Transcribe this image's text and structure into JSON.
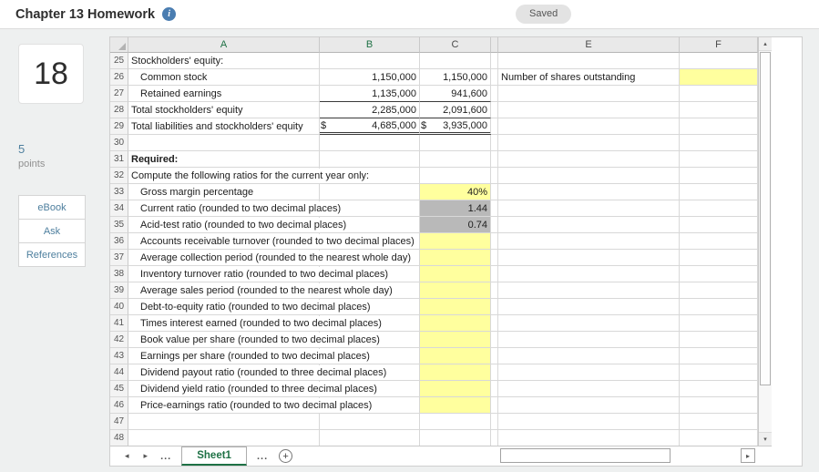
{
  "header": {
    "title": "Chapter 13 Homework",
    "saved_label": "Saved"
  },
  "sidebar": {
    "question_number": "18",
    "points_value": "5",
    "points_label": "points",
    "buttons": [
      "eBook",
      "Ask",
      "References"
    ]
  },
  "spreadsheet": {
    "columns": [
      "A",
      "B",
      "C",
      "",
      "E",
      "F"
    ],
    "rows": [
      {
        "num": "25",
        "a": "Stockholders' equity:"
      },
      {
        "num": "26",
        "a": "Common stock",
        "indent": true,
        "b": "1,150,000",
        "c": "1,150,000",
        "e": "Number of shares outstanding",
        "f_fill": "yellow"
      },
      {
        "num": "27",
        "a": "Retained earnings",
        "indent": true,
        "b": "1,135,000",
        "c": "941,600",
        "underline": "single"
      },
      {
        "num": "28",
        "a": "Total stockholders' equity",
        "b": "2,285,000",
        "c": "2,091,600",
        "underline": "single"
      },
      {
        "num": "29",
        "a": "Total liabilities and stockholders' equity",
        "b": "4,685,000",
        "b_prefix": "$",
        "c": "3,935,000",
        "c_prefix": "$",
        "underline": "double"
      },
      {
        "num": "30"
      },
      {
        "num": "31",
        "a": "Required:",
        "bold": true
      },
      {
        "num": "32",
        "a": "Compute the following ratios for the current year only:"
      },
      {
        "num": "33",
        "a": "Gross margin percentage",
        "indent": true,
        "c": "40%",
        "c_fill": "yellow"
      },
      {
        "num": "34",
        "a": "Current ratio (rounded to two decimal places)",
        "indent": true,
        "c": "1.44",
        "c_fill": "gray"
      },
      {
        "num": "35",
        "a": "Acid-test ratio (rounded to two decimal places)",
        "indent": true,
        "c": "0.74",
        "c_fill": "gray"
      },
      {
        "num": "36",
        "a": "Accounts receivable turnover (rounded to two decimal places)",
        "indent": true,
        "c_fill": "yellow"
      },
      {
        "num": "37",
        "a": "Average collection period (rounded to the nearest whole day)",
        "indent": true,
        "c_fill": "yellow"
      },
      {
        "num": "38",
        "a": "Inventory turnover ratio (rounded to two decimal places)",
        "indent": true,
        "c_fill": "yellow"
      },
      {
        "num": "39",
        "a": "Average sales period (rounded to the nearest whole day)",
        "indent": true,
        "c_fill": "yellow"
      },
      {
        "num": "40",
        "a": "Debt-to-equity ratio (rounded to two decimal places)",
        "indent": true,
        "c_fill": "yellow"
      },
      {
        "num": "41",
        "a": "Times interest earned (rounded to two decimal places)",
        "indent": true,
        "c_fill": "yellow"
      },
      {
        "num": "42",
        "a": "Book value per share (rounded to two decimal places)",
        "indent": true,
        "c_fill": "yellow"
      },
      {
        "num": "43",
        "a": "Earnings per share (rounded to two decimal places)",
        "indent": true,
        "c_fill": "yellow"
      },
      {
        "num": "44",
        "a": "Dividend payout ratio (rounded to three decimal places)",
        "indent": true,
        "c_fill": "yellow"
      },
      {
        "num": "45",
        "a": "Dividend yield ratio (rounded to three decimal places)",
        "indent": true,
        "c_fill": "yellow"
      },
      {
        "num": "46",
        "a": "Price-earnings ratio (rounded to two decimal places)",
        "indent": true,
        "c_fill": "yellow"
      },
      {
        "num": "47"
      },
      {
        "num": "48"
      }
    ]
  },
  "tabs_bar": {
    "prev": "◂",
    "next": "▸",
    "ellipsis_left": "...",
    "active_sheet": "Sheet1",
    "ellipsis_right": "...",
    "add": "+",
    "scroll_right": "▸"
  },
  "scrollbar": {
    "up": "▴",
    "down": "▾"
  },
  "colors": {
    "accent_green": "#1e7145",
    "input_yellow": "#ffff9e",
    "selected_gray": "#b9b9b9",
    "info_blue": "#4a7db1",
    "link_blue": "#4e7f9e"
  }
}
